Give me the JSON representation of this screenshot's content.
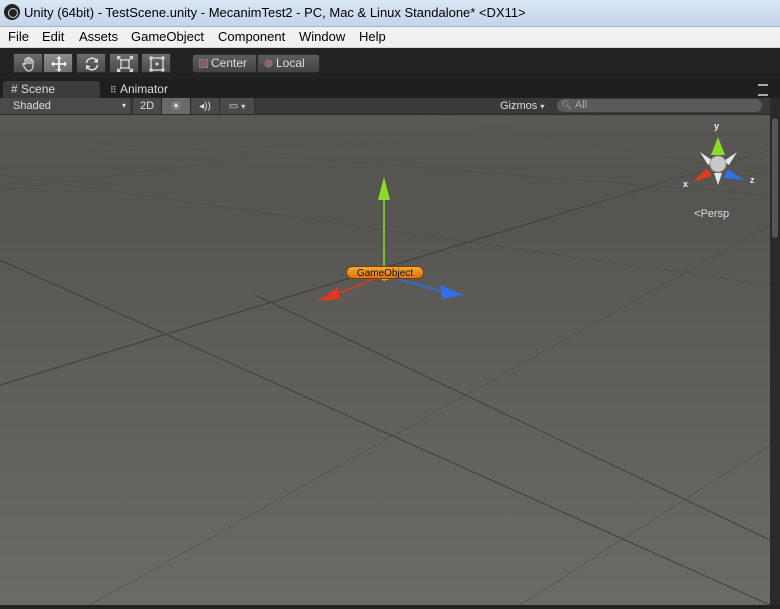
{
  "window": {
    "title": "Unity (64bit) - TestScene.unity - MecanimTest2 - PC, Mac & Linux Standalone* <DX11>"
  },
  "menu": {
    "items": [
      "File",
      "Edit",
      "Assets",
      "GameObject",
      "Component",
      "Window",
      "Help"
    ]
  },
  "toolbar": {
    "active_tool": "move",
    "pivot_label": "Center",
    "space_label": "Local"
  },
  "tabs": [
    {
      "label": "Scene",
      "icon": "grid-icon",
      "active": true
    },
    {
      "label": "Animator",
      "icon": "animator-icon",
      "active": false
    }
  ],
  "scene_toolbar": {
    "render_mode": "Shaded",
    "mode_2d": "2D",
    "gizmos_label": "Gizmos",
    "search_placeholder": "All"
  },
  "scene": {
    "selected_object": "GameObject",
    "projection_label": "Persp",
    "gizmo_axes": {
      "x": "x",
      "y": "y",
      "z": "z"
    },
    "colors": {
      "x_axis": "#e03a1c",
      "y_axis": "#8bdc2a",
      "z_axis": "#2f6fe8",
      "label": "#f0a030"
    }
  }
}
